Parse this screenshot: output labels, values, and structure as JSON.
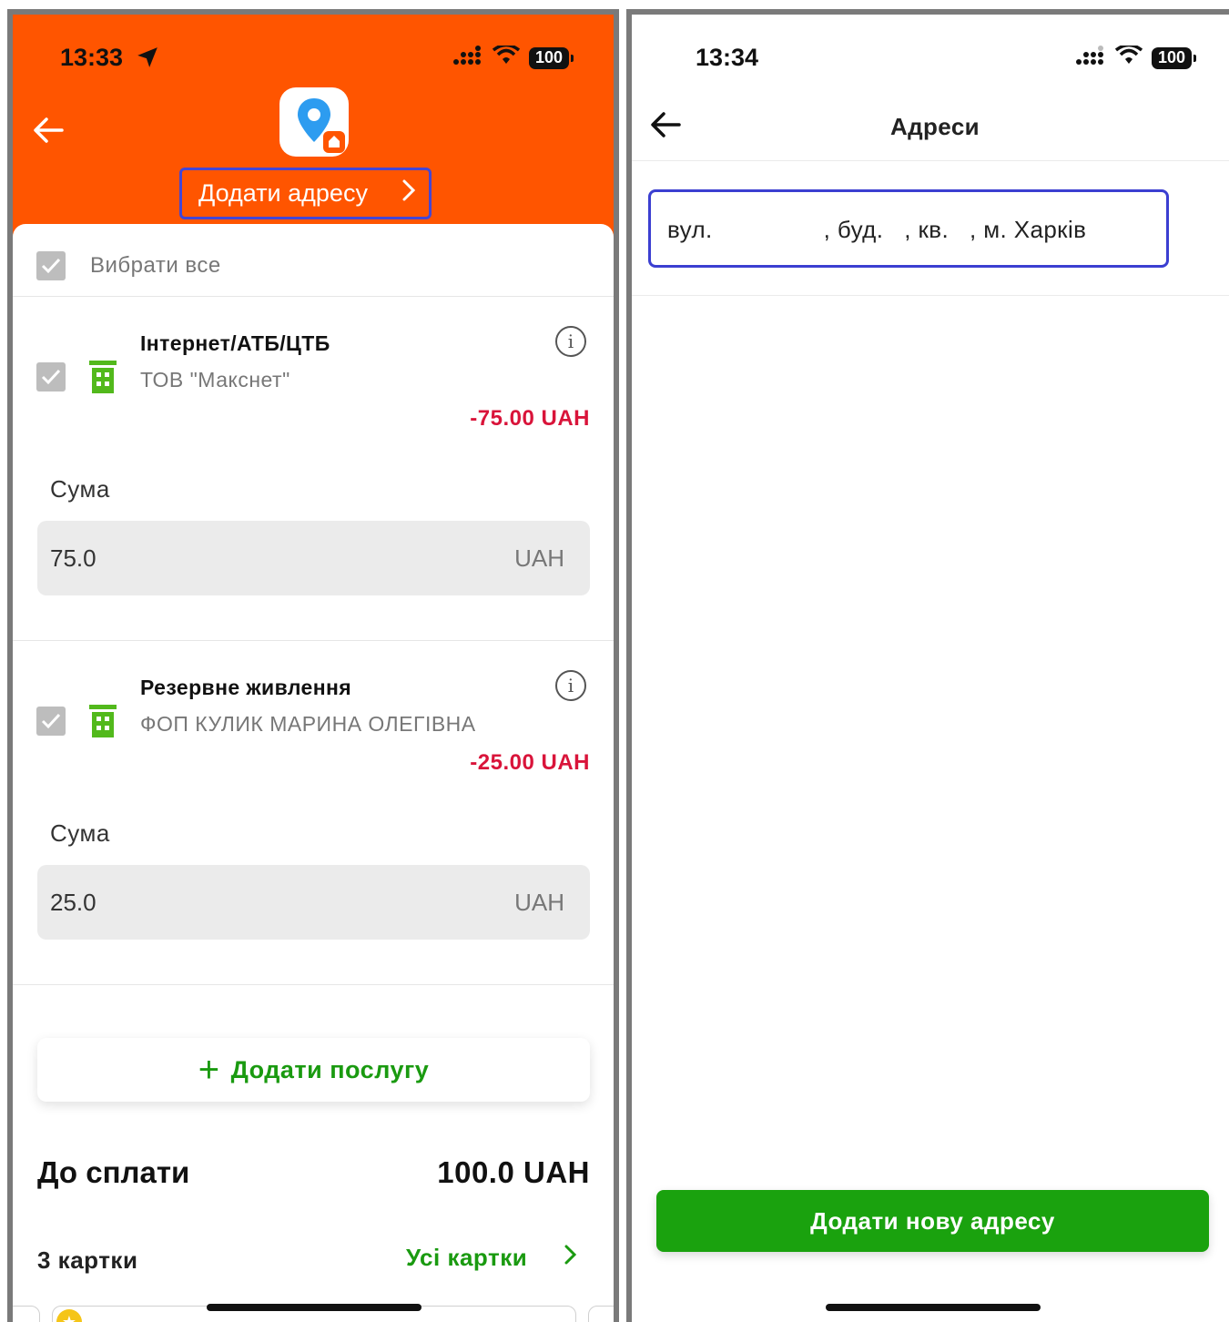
{
  "left_screen": {
    "status": {
      "time": "13:33",
      "battery": "100"
    },
    "header": {
      "add_address_label": "Додати адресу"
    },
    "select_all_label": "Вибрати все",
    "services": [
      {
        "title": "Інтернет/АТБ/ЦТБ",
        "provider": "ТОВ \"Макснет\"",
        "amount": "-75.00 UAH",
        "sum_label": "Сума",
        "sum_value": "75.0",
        "currency": "UAH"
      },
      {
        "title": "Резервне живлення",
        "provider": "ФОП КУЛИК МАРИНА ОЛЕГІВНА",
        "amount": "-25.00 UAH",
        "sum_label": "Сума",
        "sum_value": "25.0",
        "currency": "UAH"
      }
    ],
    "add_service_label": "Додати послугу",
    "total": {
      "label": "До сплати",
      "value": "100.0 UAH"
    },
    "cards": {
      "count_label": "3 картки",
      "all_cards_label": "Усі картки"
    }
  },
  "right_screen": {
    "status": {
      "time": "13:34",
      "battery": "100"
    },
    "title": "Адреси",
    "address": "вул.                , буд.   , кв.   , м. Харків",
    "add_new_label": "Додати нову адресу"
  },
  "colors": {
    "header_orange": "#ff5500",
    "accent_green": "#1aa20e",
    "amount_red": "#d9143a",
    "highlight_blue": "#3b3fd1"
  }
}
